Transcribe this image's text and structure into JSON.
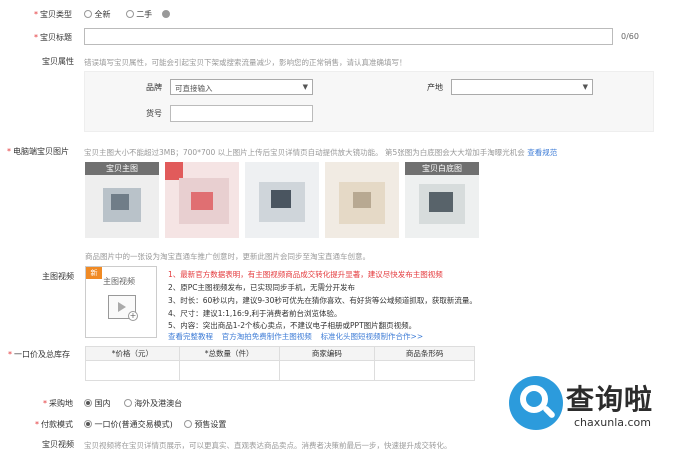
{
  "form": {
    "item_type": {
      "label": "宝贝类型",
      "options": [
        "全新",
        "二手"
      ],
      "selected": "全新"
    },
    "title": {
      "label": "宝贝标题",
      "value": "",
      "counter": "0/60"
    },
    "attributes": {
      "label": "宝贝属性",
      "hint": "错误填写宝贝属性，可能会引起宝贝下架或搜索流量减少，影响您的正常销售，请认真准确填写！",
      "brand_label": "品牌",
      "brand_value": "可直接输入",
      "origin_label": "产地",
      "origin_value": "",
      "model_label": "货号",
      "model_value": ""
    },
    "pc_images": {
      "label": "电脑端宝贝图片",
      "hint": "宝贝主图大小不能超过3MB；700*700 以上图片上传后宝贝详情页自动提供放大镜功能。 第5张图为白底图会大大增加手淘曝光机会",
      "hint_link": "查看规范",
      "thumb_captions": [
        "宝贝主图",
        "",
        "",
        "",
        "宝贝白底图"
      ],
      "note": "商品图片中的一张设为淘宝直通车推广创意时，更新此图片会同步至淘宝直通车创意。"
    },
    "main_video": {
      "label": "主图视频",
      "badge": "新",
      "box_title": "主图视频",
      "tips": [
        "1、最新官方数据表明，有主图视频商品成交转化提升显著，建议尽快发布主图视频",
        "2、原PC主图视频发布，已实现同步手机，无需分开发布",
        "3、时长：60秒以内，建议9-30秒可优先在猜你喜欢、有好货等公域频道抓取，获取新流量。",
        "4、尺寸：建议1:1,16:9,利于消费者前台浏览体验。",
        "5、内容：突出商品1-2个核心卖点，不建议电子相册或PPT图片翻页视频。"
      ],
      "links": [
        "查看完整教程",
        "官方淘拍免费制作主图视频",
        "标准化头图短视频制作合作>>"
      ]
    },
    "price_stock": {
      "label": "一口价及总库存",
      "columns": [
        "*价格（元）",
        "*总数量（件）",
        "商家编码",
        "商品条形码"
      ]
    },
    "origin": {
      "label": "采购地",
      "options": [
        "国内",
        "海外及港澳台"
      ],
      "selected": "国内"
    },
    "payment": {
      "label": "付款模式",
      "options": [
        "一口价(普通交易模式)",
        "预售设置"
      ],
      "selected": "一口价(普通交易模式)"
    },
    "item_video": {
      "label": "宝贝视频",
      "hint": "宝贝视频将在宝贝详情页展示，可以更真实、直观表达商品卖点。消费者决策前最后一步，快速提升成交转化。"
    }
  },
  "watermark": {
    "brand_cn": "查询啦",
    "brand_url": "chaxunla.com"
  },
  "colors": {
    "required_star": "#e4393c",
    "link": "#3c7bd6",
    "warning": "#e4393c",
    "watermark": "#2c9bdc"
  }
}
